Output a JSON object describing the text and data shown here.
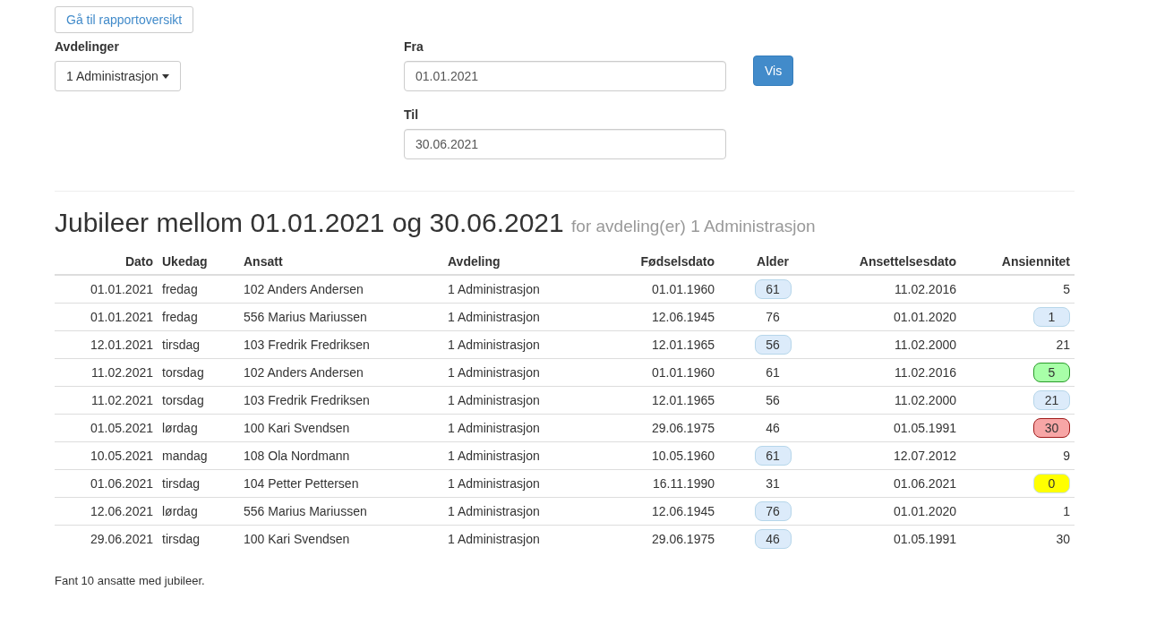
{
  "back_button": "Gå til rapportoversikt",
  "filters": {
    "departments": {
      "label": "Avdelinger",
      "value": "1 Administrasjon"
    },
    "from": {
      "label": "Fra",
      "value": "01.01.2021"
    },
    "to": {
      "label": "Til",
      "value": "30.06.2021"
    },
    "submit": "Vis"
  },
  "heading": {
    "title": "Jubileer mellom 01.01.2021 og 30.06.2021",
    "subtitle": "for avdeling(er) 1 Administrasjon"
  },
  "table": {
    "columns": [
      "Dato",
      "Ukedag",
      "Ansatt",
      "Avdeling",
      "Fødselsdato",
      "Alder",
      "Ansettelsesdato",
      "Ansiennitet"
    ],
    "rows": [
      {
        "date": "01.01.2021",
        "weekday": "fredag",
        "employee": "102 Anders Andersen",
        "department": "1 Administrasjon",
        "birth_date": "01.01.1960",
        "age": {
          "text": "61",
          "color": "#dcebfa"
        },
        "hire_date": "11.02.2016",
        "seniority": {
          "text": "5"
        }
      },
      {
        "date": "01.01.2021",
        "weekday": "fredag",
        "employee": "556 Marius Mariussen",
        "department": "1 Administrasjon",
        "birth_date": "12.06.1945",
        "age": {
          "text": "76"
        },
        "hire_date": "01.01.2020",
        "seniority": {
          "text": "1",
          "color": "#dcebfa"
        }
      },
      {
        "date": "12.01.2021",
        "weekday": "tirsdag",
        "employee": "103 Fredrik Fredriksen",
        "department": "1 Administrasjon",
        "birth_date": "12.01.1965",
        "age": {
          "text": "56",
          "color": "#dcebfa"
        },
        "hire_date": "11.02.2000",
        "seniority": {
          "text": "21"
        }
      },
      {
        "date": "11.02.2021",
        "weekday": "torsdag",
        "employee": "102 Anders Andersen",
        "department": "1 Administrasjon",
        "birth_date": "01.01.1960",
        "age": {
          "text": "61"
        },
        "hire_date": "11.02.2016",
        "seniority": {
          "text": "5",
          "color": "#a8ffa8"
        }
      },
      {
        "date": "11.02.2021",
        "weekday": "torsdag",
        "employee": "103 Fredrik Fredriksen",
        "department": "1 Administrasjon",
        "birth_date": "12.01.1965",
        "age": {
          "text": "56"
        },
        "hire_date": "11.02.2000",
        "seniority": {
          "text": "21",
          "color": "#dcebfa"
        }
      },
      {
        "date": "01.05.2021",
        "weekday": "lørdag",
        "employee": "100 Kari Svendsen",
        "department": "1 Administrasjon",
        "birth_date": "29.06.1975",
        "age": {
          "text": "46"
        },
        "hire_date": "01.05.1991",
        "seniority": {
          "text": "30",
          "color": "#f7a6a6"
        }
      },
      {
        "date": "10.05.2021",
        "weekday": "mandag",
        "employee": "108 Ola Nordmann",
        "department": "1 Administrasjon",
        "birth_date": "10.05.1960",
        "age": {
          "text": "61",
          "color": "#dcebfa"
        },
        "hire_date": "12.07.2012",
        "seniority": {
          "text": "9"
        }
      },
      {
        "date": "01.06.2021",
        "weekday": "tirsdag",
        "employee": "104 Petter Pettersen",
        "department": "1 Administrasjon",
        "birth_date": "16.11.1990",
        "age": {
          "text": "31"
        },
        "hire_date": "01.06.2021",
        "seniority": {
          "text": "0",
          "color": "#ffff00"
        }
      },
      {
        "date": "12.06.2021",
        "weekday": "lørdag",
        "employee": "556 Marius Mariussen",
        "department": "1 Administrasjon",
        "birth_date": "12.06.1945",
        "age": {
          "text": "76",
          "color": "#dcebfa"
        },
        "hire_date": "01.01.2020",
        "seniority": {
          "text": "1"
        }
      },
      {
        "date": "29.06.2021",
        "weekday": "tirsdag",
        "employee": "100 Kari Svendsen",
        "department": "1 Administrasjon",
        "birth_date": "29.06.1975",
        "age": {
          "text": "46",
          "color": "#dcebfa"
        },
        "hire_date": "01.05.1991",
        "seniority": {
          "text": "30"
        }
      }
    ]
  },
  "summary": "Fant 10 ansatte med jubileer."
}
